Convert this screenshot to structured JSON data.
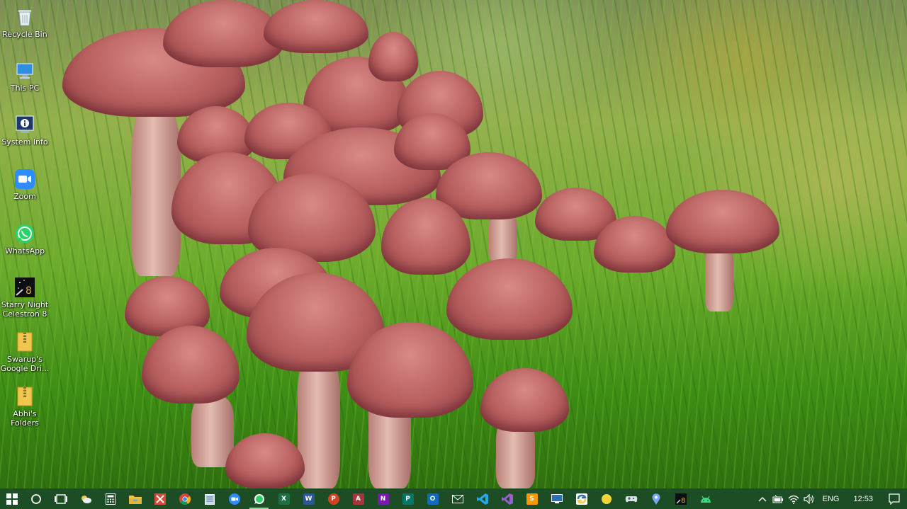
{
  "desktop": {
    "icons": [
      {
        "label": "Recycle Bin",
        "icon": "recycle-bin-icon"
      },
      {
        "label": "This PC",
        "icon": "this-pc-icon"
      },
      {
        "label": "System Info",
        "icon": "system-info-icon"
      },
      {
        "label": "Zoom",
        "icon": "zoom-icon"
      },
      {
        "label": "WhatsApp",
        "icon": "whatsapp-icon"
      },
      {
        "label": "Starry Night Celestron 8",
        "icon": "starry-night-icon"
      },
      {
        "label": "Swarup's Google Dri...",
        "icon": "folder-zip-icon"
      },
      {
        "label": "Abhi's Folders",
        "icon": "folder-zip-icon"
      }
    ]
  },
  "taskbar": {
    "apps": [
      {
        "icon": "windows-start-icon"
      },
      {
        "icon": "cortana-search-icon"
      },
      {
        "icon": "task-view-icon"
      },
      {
        "icon": "weather-app-icon"
      },
      {
        "icon": "calculator-icon"
      },
      {
        "icon": "file-explorer-icon"
      },
      {
        "icon": "snipping-tool-icon"
      },
      {
        "icon": "chrome-icon"
      },
      {
        "icon": "notepad-icon"
      },
      {
        "icon": "zoom-icon"
      },
      {
        "icon": "whatsapp-icon"
      },
      {
        "icon": "excel-icon"
      },
      {
        "icon": "word-icon"
      },
      {
        "icon": "powerpoint-icon"
      },
      {
        "icon": "access-icon"
      },
      {
        "icon": "onenote-icon"
      },
      {
        "icon": "publisher-icon"
      },
      {
        "icon": "outlook-icon"
      },
      {
        "icon": "mail-icon"
      },
      {
        "icon": "vscode-icon"
      },
      {
        "icon": "visual-studio-icon"
      },
      {
        "icon": "sublime-text-icon"
      },
      {
        "icon": "remote-desktop-icon"
      },
      {
        "icon": "python-icon"
      },
      {
        "icon": "sticky-notes-icon"
      },
      {
        "icon": "game-controller-icon"
      },
      {
        "icon": "maps-pin-icon"
      },
      {
        "icon": "starry-night-icon"
      },
      {
        "icon": "android-icon"
      }
    ],
    "tray": {
      "language": "ENG",
      "time": "12:53"
    }
  },
  "colors": {
    "taskbar": "#1d4d24",
    "active_indicator": "#8fd19e"
  }
}
